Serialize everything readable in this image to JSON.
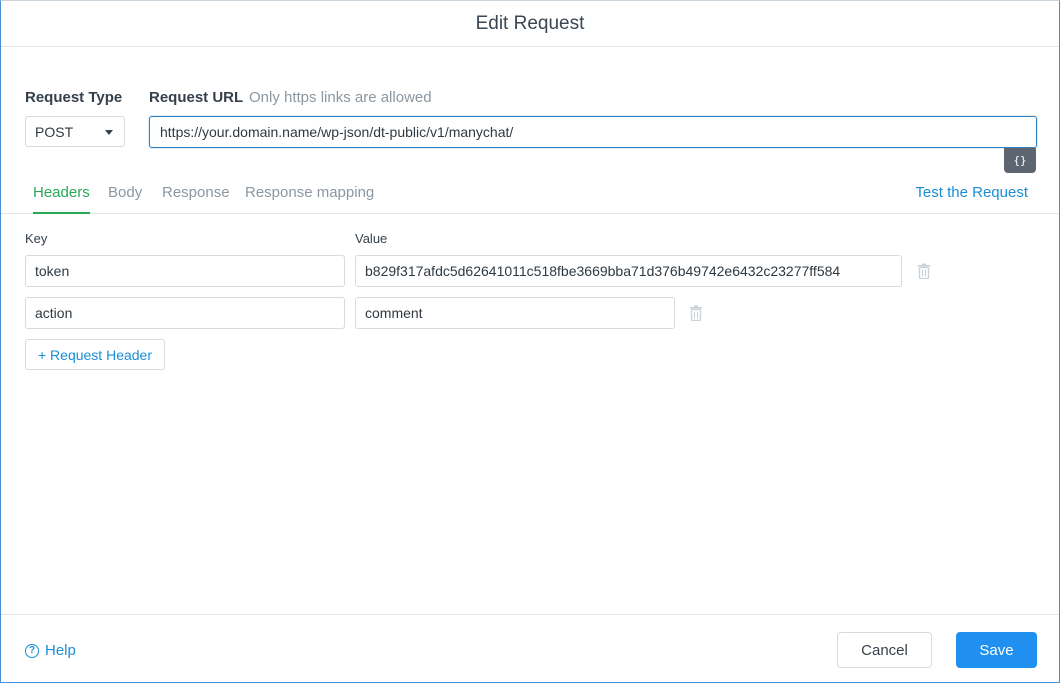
{
  "dialog": {
    "title": "Edit Request"
  },
  "request": {
    "type_label": "Request Type",
    "type_value": "POST",
    "url_label": "Request URL",
    "url_hint": "Only https links are allowed",
    "url_value": "https://your.domain.name/wp-json/dt-public/v1/manychat/",
    "var_button": "{}"
  },
  "tabs": [
    {
      "label": "Headers",
      "active": true
    },
    {
      "label": "Body",
      "active": false
    },
    {
      "label": "Response",
      "active": false
    },
    {
      "label": "Response mapping",
      "active": false
    }
  ],
  "test_link": "Test the Request",
  "headers": {
    "key_label": "Key",
    "value_label": "Value",
    "rows": [
      {
        "key": "token",
        "value": "b829f317afdc5d62641011c518fbe3669bba71d376b49742e6432c23277ff584"
      },
      {
        "key": "action",
        "value": "comment"
      }
    ],
    "add_button": "+ Request Header"
  },
  "footer": {
    "help_label": "Help",
    "help_icon": "?",
    "cancel_label": "Cancel",
    "save_label": "Save"
  },
  "colors": {
    "accent": "#1f8ff0",
    "active_tab": "#27a956",
    "link": "#1a8ed3"
  }
}
